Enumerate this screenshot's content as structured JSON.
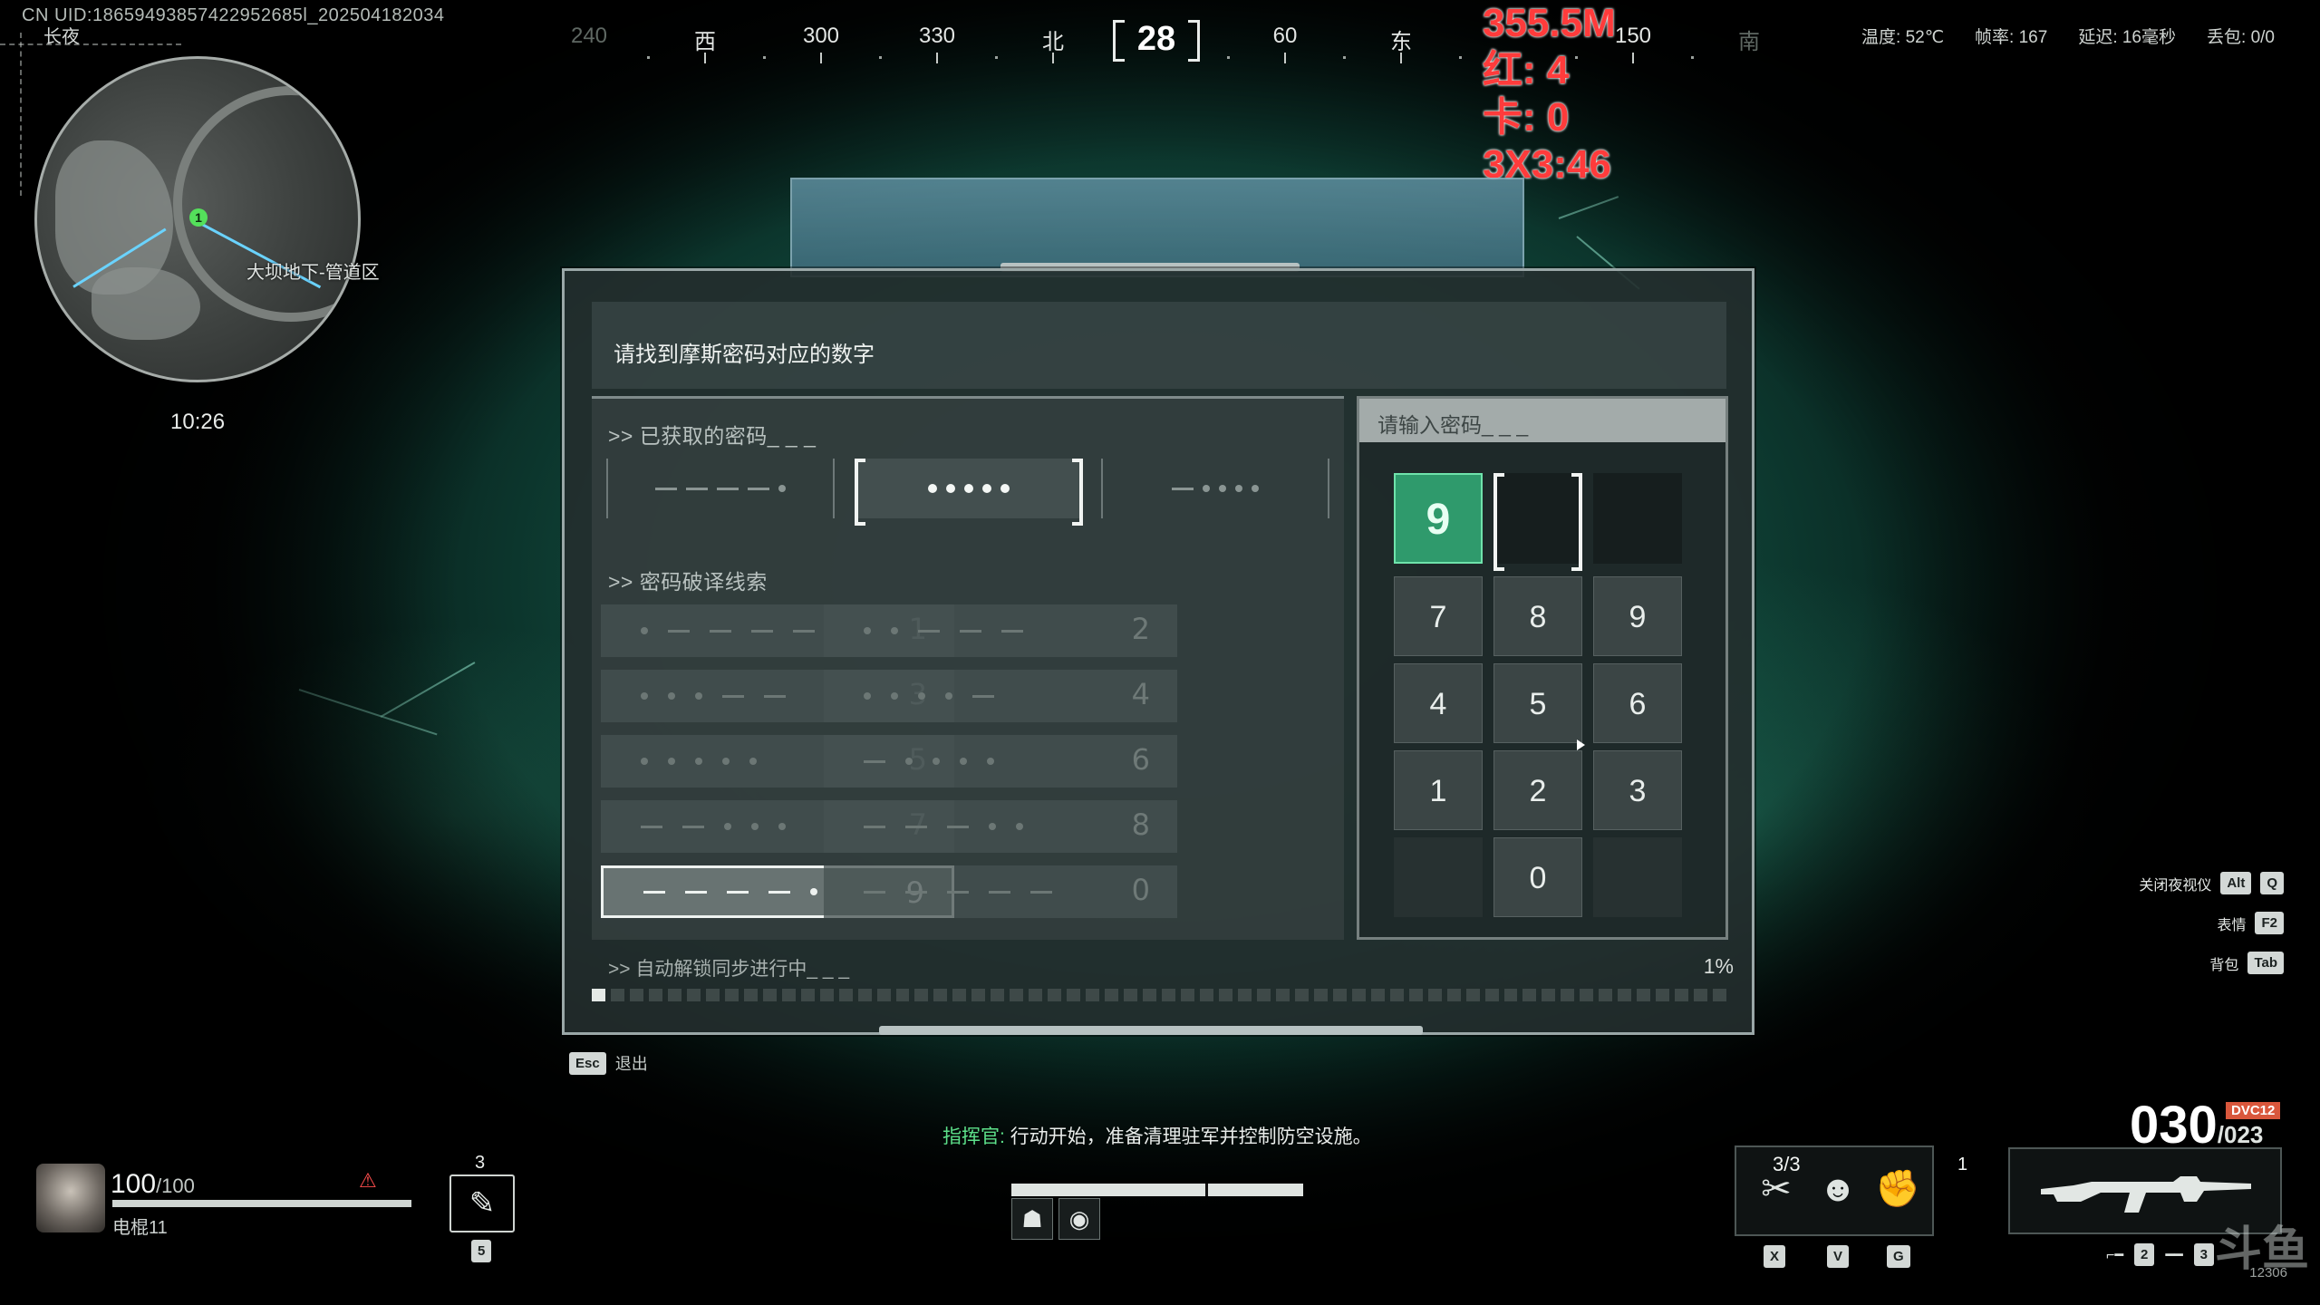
{
  "top": {
    "uid": "CN UID:18659493857422952685l_202504182034",
    "server": "长夜",
    "heading": "28",
    "compass": [
      "240",
      "西",
      "300",
      "330",
      "北",
      "60",
      "东",
      "150",
      "南"
    ],
    "overlay_stats": [
      "355.5M",
      "红: 4",
      "卡: 0",
      "3X3:46"
    ],
    "sysinfo": [
      "温度: 52℃",
      "帧率: 167",
      "延迟: 16毫秒",
      "丢包: 0/0"
    ]
  },
  "minimap": {
    "player_marker": "1",
    "location": "大坝地下-管道区",
    "time": "10:26"
  },
  "panel": {
    "title": "请找到摩斯密码对应的数字",
    "acquired_label": ">> 已获取的密码_ _ _",
    "acquired_codes": [
      {
        "pattern": "----.",
        "active": false
      },
      {
        "pattern": ".....",
        "active": true
      },
      {
        "pattern": "-....",
        "active": false
      }
    ],
    "clues_label": ">> 密码破译线索",
    "clues": [
      {
        "pattern": ".----",
        "digit": "1"
      },
      {
        "pattern": "..---",
        "digit": "2"
      },
      {
        "pattern": "...--",
        "digit": "3"
      },
      {
        "pattern": "....-",
        "digit": "4"
      },
      {
        "pattern": ".....",
        "digit": "5"
      },
      {
        "pattern": "-....",
        "digit": "6"
      },
      {
        "pattern": "--...",
        "digit": "7"
      },
      {
        "pattern": "---..",
        "digit": "8"
      },
      {
        "pattern": "----.",
        "digit": "9",
        "highlight": true
      },
      {
        "pattern": "-----",
        "digit": "0"
      }
    ],
    "keypad_header": "请输入密码_ _ _",
    "entered": [
      "9",
      "",
      ""
    ],
    "keys": [
      "7",
      "8",
      "9",
      "4",
      "5",
      "6",
      "1",
      "2",
      "3",
      "0"
    ],
    "progress_label": ">> 自动解锁同步进行中_ _ _",
    "progress_pct": "1%",
    "progress_value": 0.01
  },
  "esc": {
    "key": "Esc",
    "label": "退出"
  },
  "commander": {
    "who": "指挥官:",
    "text": "行动开始，准备清理驻军并控制防空设施。"
  },
  "player": {
    "hp": "100",
    "hp_max": "/100",
    "name": "电棍11"
  },
  "slot5": {
    "count": "3",
    "key": "5"
  },
  "hints": [
    {
      "label": "关闭夜视仪",
      "keys": [
        "Alt",
        "Q"
      ]
    },
    {
      "label": "表情",
      "keys": [
        "F2"
      ]
    },
    {
      "label": "背包",
      "keys": [
        "Tab"
      ]
    }
  ],
  "equipment": {
    "count": "3/3",
    "extra": "1",
    "keys": [
      "X",
      "V",
      "G"
    ]
  },
  "weapon": {
    "mag": "030",
    "reserve": "/023",
    "tag": "DVC12",
    "slot_keys": [
      "2",
      "3"
    ]
  },
  "watermark": {
    "text": "斗鱼",
    "id": "12306"
  },
  "colors": {
    "accent_green": "#2f9a6c",
    "commander_green": "#5de08a",
    "overlay_red": "#ff3b3b"
  }
}
